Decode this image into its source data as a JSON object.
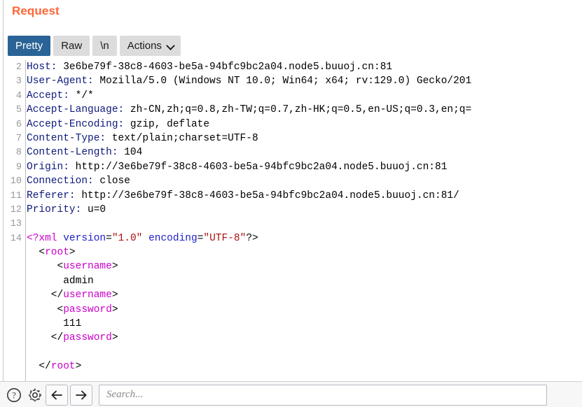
{
  "panel": {
    "title": "Request"
  },
  "toolbar": {
    "tabs": [
      {
        "label": "Pretty",
        "selected": true
      },
      {
        "label": "Raw",
        "selected": false
      },
      {
        "label": "\\n",
        "selected": false
      }
    ],
    "actions_label": "Actions"
  },
  "editor": {
    "first_visible_line": 2,
    "lines": [
      {
        "number": "2",
        "segments": [
          {
            "text": "Host:",
            "kind": "header-name"
          },
          {
            "text": " 3e6be79f-38c8-4603-be5a-94bfc9bc2a04.node5.buuoj.cn:81",
            "kind": "header-value"
          }
        ]
      },
      {
        "number": "3",
        "segments": [
          {
            "text": "User-Agent:",
            "kind": "header-name"
          },
          {
            "text": " Mozilla/5.0 (Windows NT 10.0; Win64; x64; rv:129.0) Gecko/201",
            "kind": "header-value"
          }
        ]
      },
      {
        "number": "4",
        "segments": [
          {
            "text": "Accept:",
            "kind": "header-name"
          },
          {
            "text": " */*",
            "kind": "header-value"
          }
        ]
      },
      {
        "number": "5",
        "segments": [
          {
            "text": "Accept-Language:",
            "kind": "header-name"
          },
          {
            "text": " zh-CN,zh;q=0.8,zh-TW;q=0.7,zh-HK;q=0.5,en-US;q=0.3,en;q=",
            "kind": "header-value"
          }
        ]
      },
      {
        "number": "6",
        "segments": [
          {
            "text": "Accept-Encoding:",
            "kind": "header-name"
          },
          {
            "text": " gzip, deflate",
            "kind": "header-value"
          }
        ]
      },
      {
        "number": "7",
        "segments": [
          {
            "text": "Content-Type:",
            "kind": "header-name"
          },
          {
            "text": " text/plain;charset=UTF-8",
            "kind": "header-value"
          }
        ]
      },
      {
        "number": "8",
        "segments": [
          {
            "text": "Content-Length:",
            "kind": "header-name"
          },
          {
            "text": " 104",
            "kind": "header-value"
          }
        ]
      },
      {
        "number": "9",
        "segments": [
          {
            "text": "Origin:",
            "kind": "header-name"
          },
          {
            "text": " http://3e6be79f-38c8-4603-be5a-94bfc9bc2a04.node5.buuoj.cn:81",
            "kind": "header-value"
          }
        ]
      },
      {
        "number": "10",
        "segments": [
          {
            "text": "Connection:",
            "kind": "header-name"
          },
          {
            "text": " close",
            "kind": "header-value"
          }
        ]
      },
      {
        "number": "11",
        "segments": [
          {
            "text": "Referer:",
            "kind": "header-name"
          },
          {
            "text": " http://3e6be79f-38c8-4603-be5a-94bfc9bc2a04.node5.buuoj.cn:81/",
            "kind": "header-value"
          }
        ]
      },
      {
        "number": "12",
        "segments": [
          {
            "text": "Priority:",
            "kind": "header-name"
          },
          {
            "text": " u=0",
            "kind": "header-value"
          }
        ]
      },
      {
        "number": "13",
        "segments": []
      },
      {
        "number": "14",
        "segments": [
          {
            "text": "<?xml",
            "kind": "xml-decl"
          },
          {
            "text": " ",
            "kind": "plain"
          },
          {
            "text": "version",
            "kind": "xml-attr"
          },
          {
            "text": "=",
            "kind": "plain"
          },
          {
            "text": "\"1.0\"",
            "kind": "xml-string"
          },
          {
            "text": " ",
            "kind": "plain"
          },
          {
            "text": "encoding",
            "kind": "xml-attr"
          },
          {
            "text": "=",
            "kind": "plain"
          },
          {
            "text": "\"UTF-8\"",
            "kind": "xml-string"
          },
          {
            "text": "?>",
            "kind": "plain"
          }
        ]
      },
      {
        "number": "",
        "segments": [
          {
            "text": "  <",
            "kind": "plain"
          },
          {
            "text": "root",
            "kind": "xml-tag"
          },
          {
            "text": ">",
            "kind": "plain"
          }
        ]
      },
      {
        "number": "",
        "segments": [
          {
            "text": "     <",
            "kind": "plain"
          },
          {
            "text": "username",
            "kind": "xml-tag"
          },
          {
            "text": ">",
            "kind": "plain"
          }
        ]
      },
      {
        "number": "",
        "segments": [
          {
            "text": "      admin",
            "kind": "xml-text"
          }
        ]
      },
      {
        "number": "",
        "segments": [
          {
            "text": "    </",
            "kind": "plain"
          },
          {
            "text": "username",
            "kind": "xml-tag"
          },
          {
            "text": ">",
            "kind": "plain"
          }
        ]
      },
      {
        "number": "",
        "segments": [
          {
            "text": "     <",
            "kind": "plain"
          },
          {
            "text": "password",
            "kind": "xml-tag"
          },
          {
            "text": ">",
            "kind": "plain"
          }
        ]
      },
      {
        "number": "",
        "segments": [
          {
            "text": "      111",
            "kind": "xml-text"
          }
        ]
      },
      {
        "number": "",
        "segments": [
          {
            "text": "    </",
            "kind": "plain"
          },
          {
            "text": "password",
            "kind": "xml-tag"
          },
          {
            "text": ">",
            "kind": "plain"
          }
        ]
      },
      {
        "number": "",
        "segments": []
      },
      {
        "number": "",
        "segments": [
          {
            "text": "  </",
            "kind": "plain"
          },
          {
            "text": "root",
            "kind": "xml-tag"
          },
          {
            "text": ">",
            "kind": "plain"
          }
        ]
      }
    ]
  },
  "bottom_bar": {
    "help_icon": "question-mark-circle-icon",
    "settings_icon": "gear-icon",
    "back_icon": "arrow-left-icon",
    "forward_icon": "arrow-right-icon",
    "search_placeholder": "Search...",
    "search_value": ""
  },
  "colors": {
    "title_orange": "#ff6633",
    "tab_selected_blue": "#2a6496",
    "tab_background": "#dcdcdc",
    "header_name_blue": "#0e1a7a",
    "xml_tag_magenta": "#cc00cc",
    "xml_attr_blue": "#2020cc",
    "xml_string_red": "#aa1111",
    "gutter_gray": "#999999"
  }
}
